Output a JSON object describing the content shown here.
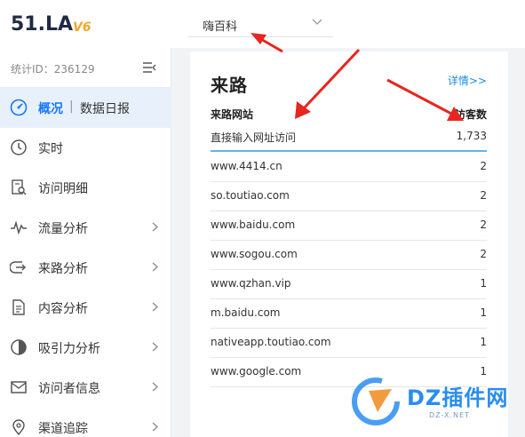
{
  "brand": {
    "logo_text": "51.LA",
    "version": "V6"
  },
  "site_selector": {
    "value": "嗨百科"
  },
  "sidebar": {
    "stat_id": "统计ID：236129",
    "items": [
      {
        "label": "概况",
        "sub": "数据日报",
        "icon": "dashboard-icon",
        "active": true
      },
      {
        "label": "实时",
        "icon": "clock-icon"
      },
      {
        "label": "访问明细",
        "icon": "visit-detail-icon"
      },
      {
        "label": "流量分析",
        "icon": "traffic-pulse-icon",
        "expandable": true
      },
      {
        "label": "来路分析",
        "icon": "referrer-icon",
        "expandable": true
      },
      {
        "label": "内容分析",
        "icon": "document-icon",
        "expandable": true
      },
      {
        "label": "吸引力分析",
        "icon": "attraction-icon",
        "expandable": true
      },
      {
        "label": "访问者信息",
        "icon": "mail-icon",
        "expandable": true
      },
      {
        "label": "渠道追踪",
        "icon": "location-pin-icon",
        "expandable": true
      }
    ],
    "separator": "|"
  },
  "card": {
    "title": "来路",
    "more_link": "详情>>",
    "headers": {
      "source": "来路网站",
      "visitors": "访客数"
    },
    "rows": [
      {
        "source": "直接输入网址访问",
        "visitors": "1,733"
      },
      {
        "source": "www.4414.cn",
        "visitors": "2"
      },
      {
        "source": "so.toutiao.com",
        "visitors": "2"
      },
      {
        "source": "www.baidu.com",
        "visitors": "2"
      },
      {
        "source": "www.sogou.com",
        "visitors": "2"
      },
      {
        "source": "www.qzhan.vip",
        "visitors": "1"
      },
      {
        "source": "m.baidu.com",
        "visitors": "1"
      },
      {
        "source": "nativeapp.toutiao.com",
        "visitors": "1"
      },
      {
        "source": "www.google.com",
        "visitors": "1"
      }
    ]
  },
  "watermark": {
    "text": "DZ插件网",
    "sub": "DZ-X.NET"
  },
  "colors": {
    "accent": "#1677ff",
    "link": "#1a8ce2",
    "annotation": "#e8251f",
    "watermark": "#2a8df0"
  }
}
